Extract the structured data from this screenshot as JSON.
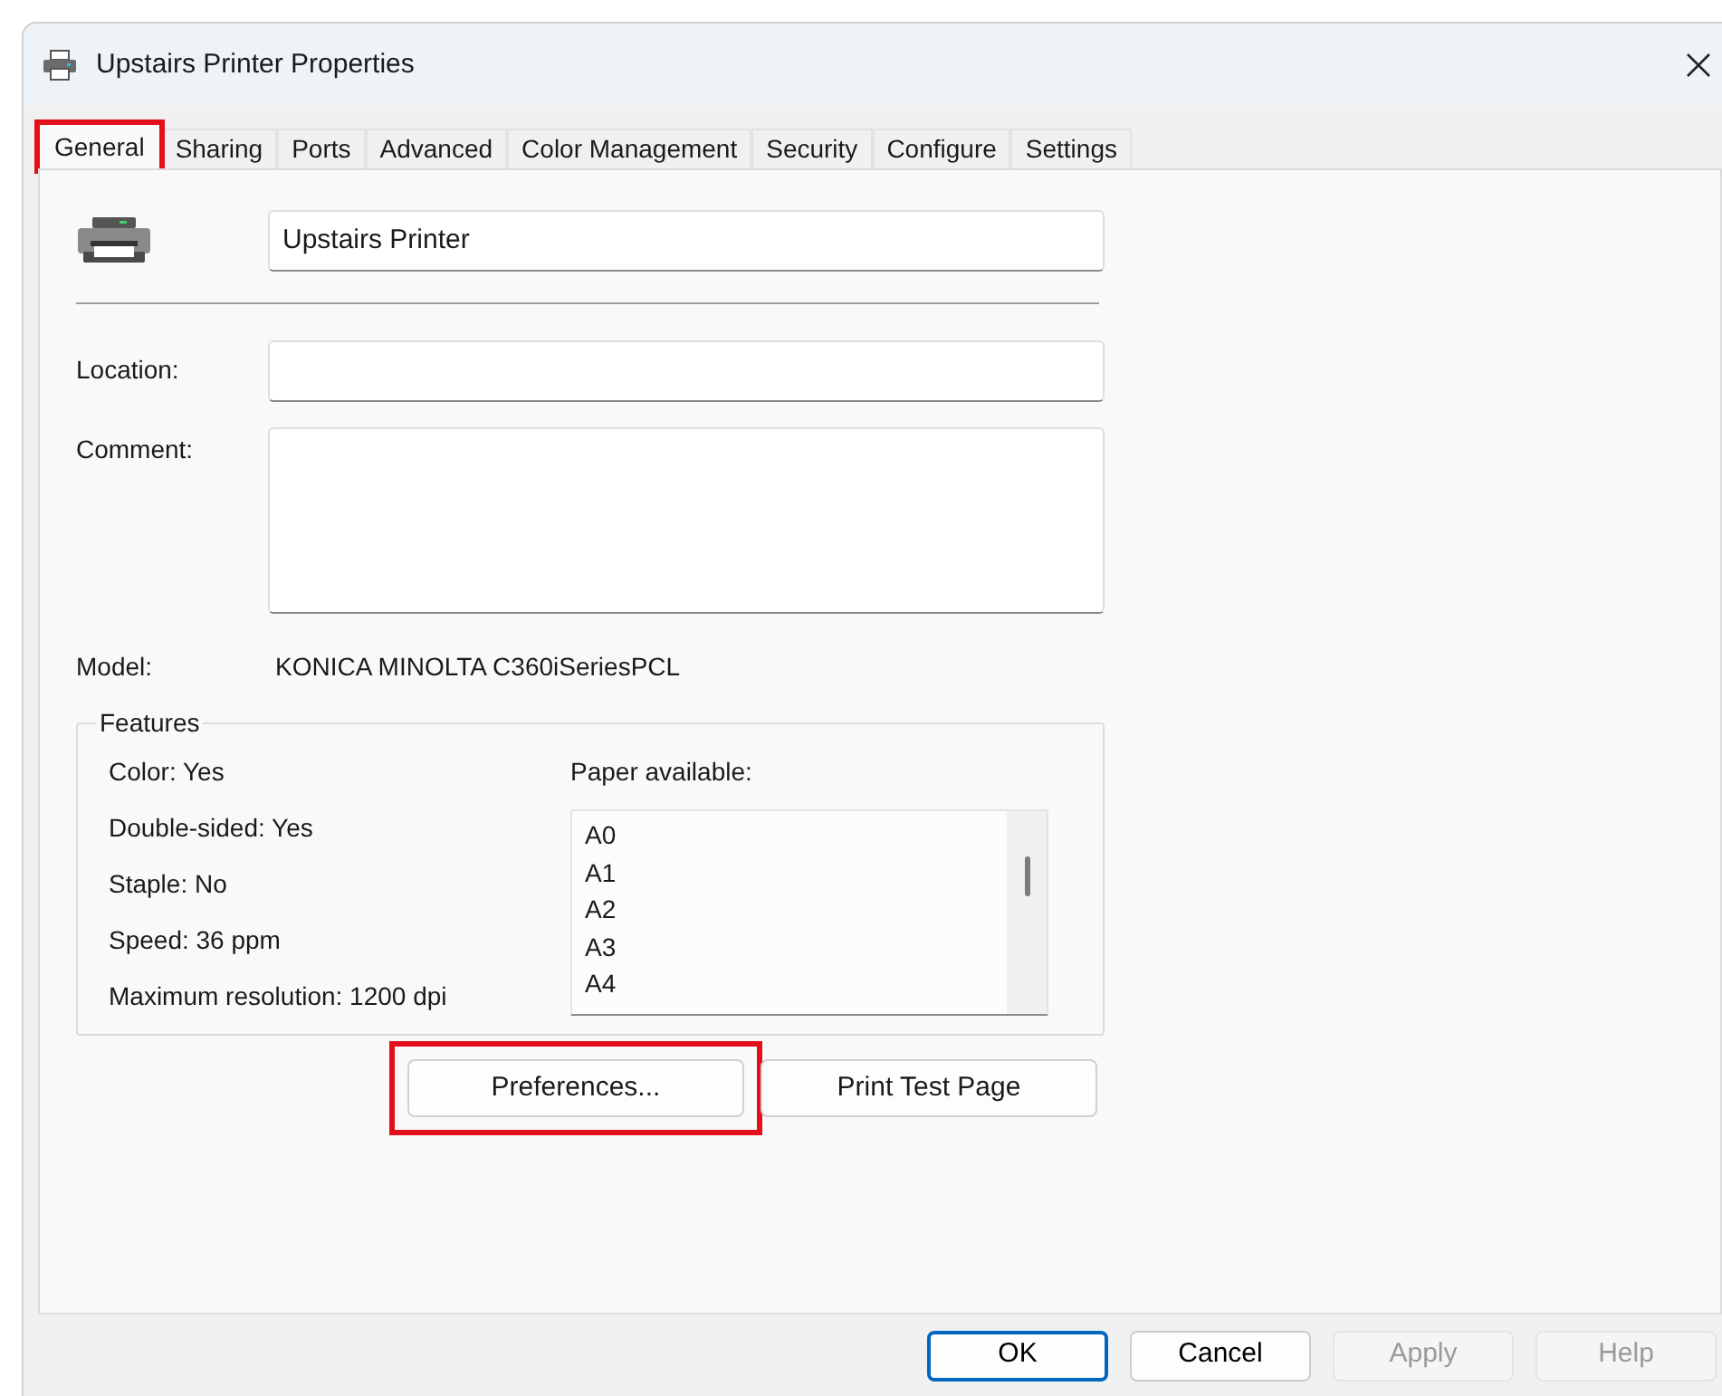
{
  "window": {
    "title": "Upstairs Printer Properties"
  },
  "tabs": [
    {
      "label": "General",
      "selected": true,
      "highlighted": true
    },
    {
      "label": "Sharing",
      "selected": false,
      "highlighted": false
    },
    {
      "label": "Ports",
      "selected": false,
      "highlighted": false
    },
    {
      "label": "Advanced",
      "selected": false,
      "highlighted": false
    },
    {
      "label": "Color Management",
      "selected": false,
      "highlighted": false
    },
    {
      "label": "Security",
      "selected": false,
      "highlighted": false
    },
    {
      "label": "Configure",
      "selected": false,
      "highlighted": false
    },
    {
      "label": "Settings",
      "selected": false,
      "highlighted": false
    }
  ],
  "printer_name": {
    "value": "Upstairs Printer"
  },
  "location": {
    "label": "Location:"
  },
  "comment": {
    "label": "Comment:"
  },
  "model": {
    "label": "Model:",
    "value": "KONICA MINOLTA C360iSeriesPCL"
  },
  "features": {
    "title": "Features",
    "items": [
      "Color: Yes",
      "Double-sided: Yes",
      "Staple: No",
      "Speed: 36 ppm",
      "Maximum resolution: 1200 dpi"
    ],
    "paper_label": "Paper available:",
    "paper": [
      "A0",
      "A1",
      "A2",
      "A3",
      "A4"
    ]
  },
  "actions": [
    {
      "label": "Preferences...",
      "highlighted": true
    },
    {
      "label": "Print Test Page",
      "highlighted": false
    }
  ],
  "buttons": [
    {
      "label": "OK",
      "default": true,
      "disabled": false
    },
    {
      "label": "Cancel",
      "default": false,
      "disabled": false
    },
    {
      "label": "Apply",
      "default": false,
      "disabled": true
    },
    {
      "label": "Help",
      "default": false,
      "disabled": true
    }
  ]
}
